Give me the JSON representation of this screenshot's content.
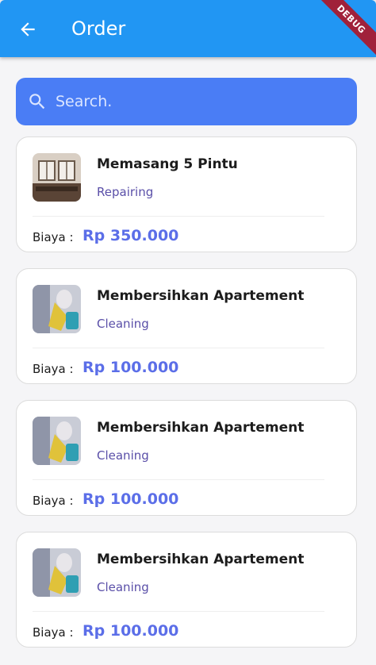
{
  "appbar": {
    "title": "Order",
    "back_icon": "arrow-left-icon",
    "debug_badge": "DEBUG"
  },
  "search": {
    "placeholder": "Search.",
    "icon": "search-icon"
  },
  "orders": [
    {
      "title": "Memasang 5 Pintu",
      "category": "Repairing",
      "cost_label": "Biaya :",
      "cost": "Rp 350.000",
      "image": "door-photo"
    },
    {
      "title": "Membersihkan Apartement",
      "category": "Cleaning",
      "cost_label": "Biaya :",
      "cost": "Rp 100.000",
      "image": "cleaning-photo"
    },
    {
      "title": "Membersihkan Apartement",
      "category": "Cleaning",
      "cost_label": "Biaya :",
      "cost": "Rp 100.000",
      "image": "cleaning-photo"
    },
    {
      "title": "Membersihkan Apartement",
      "category": "Cleaning",
      "cost_label": "Biaya :",
      "cost": "Rp 100.000",
      "image": "cleaning-photo"
    }
  ],
  "colors": {
    "appbar": "#2196f3",
    "search": "#4a7df5",
    "price": "#5b6ee8",
    "category": "#5a4fa8",
    "debug": "#a0213a"
  }
}
